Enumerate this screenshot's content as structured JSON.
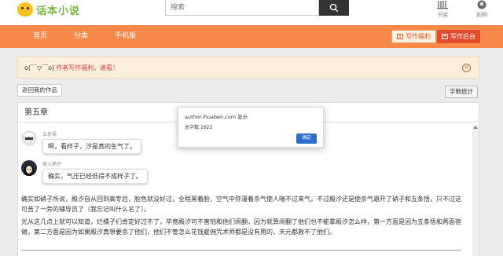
{
  "header": {
    "logo_text": "话本小说",
    "search_placeholder": "搜索",
    "icons": [
      {
        "label": "书架",
        "icon": "bookshelf-icon"
      },
      {
        "label": "剧啊",
        "icon": "avatar-icon"
      }
    ]
  },
  "nav": {
    "items": [
      "首页",
      "分类",
      "手机版"
    ],
    "welfare_label": "写作福利",
    "backend_label": "写作后台"
  },
  "alert": {
    "face": "o(￣▽￣o)",
    "text": "作者写作福利，速看！"
  },
  "toolbar": {
    "back_label": "返回我的作品",
    "count_label": "字数统计"
  },
  "chapter": {
    "title": "第五章",
    "messages": [
      {
        "name": "五条悟",
        "text": "啊，看样子，汐是真的生气了。"
      },
      {
        "name": "家入硝子",
        "text": "确实，气压已经低得不成样子了。"
      }
    ],
    "paragraphs": [
      "确实如硝子所说，殿汐自从回到高专后，脸色就没好过，全程黑着脸，空气中弥漫着杀气使人喘不过来气，不过殿汐还是使杀气避开了硝子和五条悟，只不过这可苦了一旁的辅导员了（我忘记叫什么名了）。",
      "光从这几点上就可以知道，烂橘子们肯定好过不了，毕竟殿汐可不害怕和他们闹翻，因为就算闹翻了他们也不能拿殿汐怎么样，第一方面是因为五条悟和两面宿傩，第二方面是因为如果殿汐真想要杀了他们，他们不管怎么花钱雇佣咒术师都是没有用的，天元都救不了他们。"
    ]
  },
  "dialog": {
    "title": "author.ihuaben.com 显示",
    "message": "总字数:1622",
    "ok_label": "确定"
  },
  "colors": {
    "nav_bg": "#f6894a",
    "alert_bg": "#fbeedb",
    "backend_btn": "#e34b2f",
    "dialog_ok": "#2f6fcf"
  }
}
